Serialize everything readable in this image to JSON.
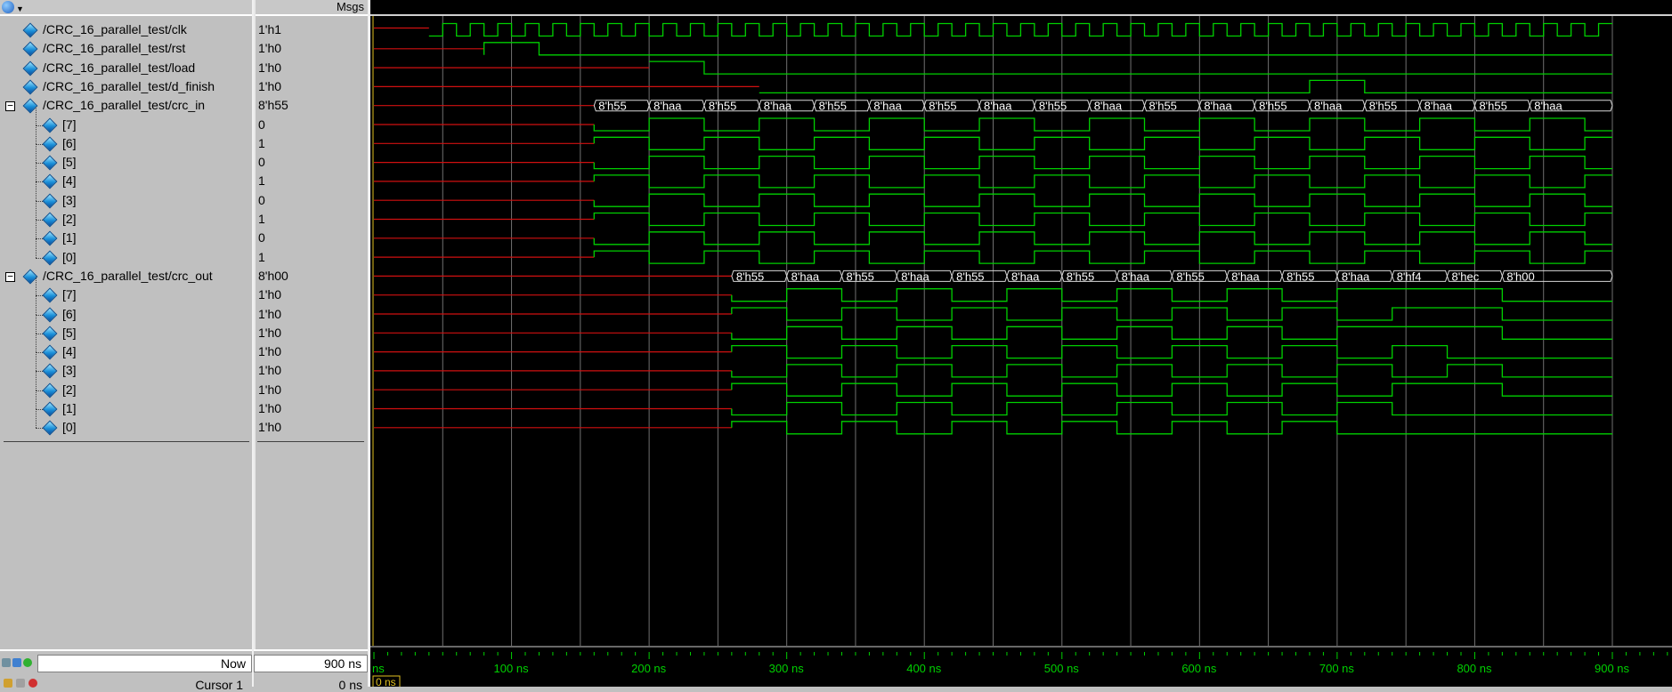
{
  "headers": {
    "msgs": "Msgs"
  },
  "signals": [
    {
      "name": "/CRC_16_parallel_test/clk",
      "value": "1'h1",
      "level": 0
    },
    {
      "name": "/CRC_16_parallel_test/rst",
      "value": "1'h0",
      "level": 0
    },
    {
      "name": "/CRC_16_parallel_test/load",
      "value": "1'h0",
      "level": 0
    },
    {
      "name": "/CRC_16_parallel_test/d_finish",
      "value": "1'h0",
      "level": 0
    },
    {
      "name": "/CRC_16_parallel_test/crc_in",
      "value": "8'h55",
      "level": 0,
      "expanded": true
    },
    {
      "name": "[7]",
      "value": "0",
      "level": 1
    },
    {
      "name": "[6]",
      "value": "1",
      "level": 1
    },
    {
      "name": "[5]",
      "value": "0",
      "level": 1
    },
    {
      "name": "[4]",
      "value": "1",
      "level": 1
    },
    {
      "name": "[3]",
      "value": "0",
      "level": 1
    },
    {
      "name": "[2]",
      "value": "1",
      "level": 1
    },
    {
      "name": "[1]",
      "value": "0",
      "level": 1
    },
    {
      "name": "[0]",
      "value": "1",
      "level": 1
    },
    {
      "name": "/CRC_16_parallel_test/crc_out",
      "value": "8'h00",
      "level": 0,
      "expanded": true
    },
    {
      "name": "[7]",
      "value": "1'h0",
      "level": 1
    },
    {
      "name": "[6]",
      "value": "1'h0",
      "level": 1
    },
    {
      "name": "[5]",
      "value": "1'h0",
      "level": 1
    },
    {
      "name": "[4]",
      "value": "1'h0",
      "level": 1
    },
    {
      "name": "[3]",
      "value": "1'h0",
      "level": 1
    },
    {
      "name": "[2]",
      "value": "1'h0",
      "level": 1
    },
    {
      "name": "[1]",
      "value": "1'h0",
      "level": 1
    },
    {
      "name": "[0]",
      "value": "1'h0",
      "level": 1
    }
  ],
  "crc_in_bus_labels": [
    "8'h55",
    "8'haa",
    "8'h55",
    "8'haa",
    "8'h55",
    "8'haa",
    "8'h55",
    "8'haa",
    "8'h55",
    "8'haa",
    "8'h55",
    "8'haa",
    "8'h55",
    "8'haa",
    "8'h55",
    "8'haa",
    "8'h55",
    "8'haa"
  ],
  "crc_out_bus_labels": [
    "8'h55",
    "8'haa",
    "8'h55",
    "8'haa",
    "8'h55",
    "8'haa",
    "8'h55",
    "8'haa",
    "8'h55",
    "8'haa",
    "8'h55",
    "8'haa",
    "8'hf4",
    "8'hec",
    "8'h00"
  ],
  "timeline": {
    "ticks": [
      "ns",
      "100 ns",
      "200 ns",
      "300 ns",
      "400 ns",
      "500 ns",
      "600 ns",
      "700 ns",
      "800 ns",
      "900 ns"
    ],
    "range_ns": [
      0,
      900
    ]
  },
  "footer": {
    "now_label": "Now",
    "now_value": "900 ns",
    "cursor_label": "Cursor 1",
    "cursor_value": "0 ns",
    "cursor_tag": "0 ns"
  },
  "colors": {
    "wave_green": "#00d000",
    "undefined_red": "#d01010",
    "grid": "#808080",
    "cursor": "#e0c020",
    "bus_text": "#ffffff",
    "tick_text": "#00d000"
  }
}
